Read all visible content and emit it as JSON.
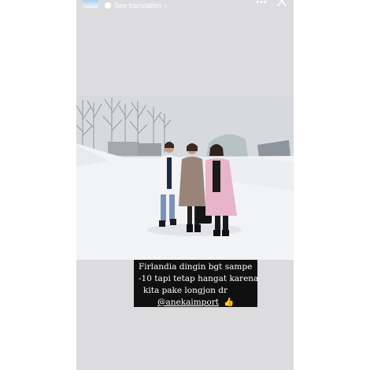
{
  "header": {
    "translation_label": "See translation",
    "chevron": "›",
    "more": "•••",
    "avatar_icon": "profile-avatar",
    "globe_icon": "globe-icon",
    "close_icon": "close-icon"
  },
  "caption": {
    "line1": "Firlandia dingin bgt sampe",
    "line2": "-10 tapi tetap hangat karena",
    "line3": "kita pake longjon dr",
    "mention": "@anekaimport",
    "emoji": "👍"
  },
  "colors": {
    "story_background": "#dcdcde",
    "caption_background": "#101010",
    "caption_text": "#ffffff"
  }
}
